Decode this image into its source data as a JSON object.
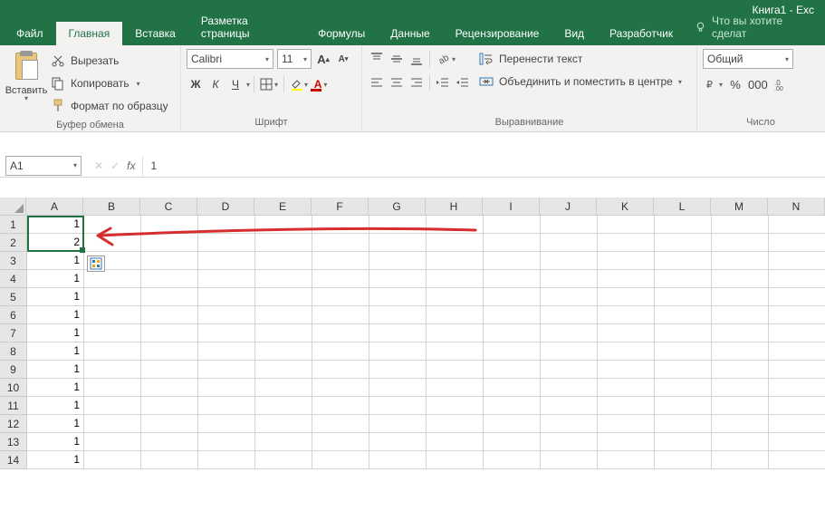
{
  "titlebar": {
    "title": "Книга1 - Exc"
  },
  "tabs": {
    "file": "Файл",
    "items": [
      "Главная",
      "Вставка",
      "Разметка страницы",
      "Формулы",
      "Данные",
      "Рецензирование",
      "Вид",
      "Разработчик"
    ],
    "active_index": 0,
    "tellme": "Что вы хотите сделат"
  },
  "ribbon": {
    "clipboard": {
      "paste": "Вставить",
      "cut": "Вырезать",
      "copy": "Копировать",
      "format_painter": "Формат по образцу",
      "label": "Буфер обмена"
    },
    "font": {
      "name": "Calibri",
      "size": "11",
      "label": "Шрифт",
      "bold": "Ж",
      "italic": "К",
      "underline": "Ч"
    },
    "alignment": {
      "wrap": "Перенести текст",
      "merge": "Объединить и поместить в центре",
      "label": "Выравнивание"
    },
    "number": {
      "format": "Общий",
      "label": "Число"
    }
  },
  "formula_bar": {
    "cell_ref": "A1",
    "formula": "1"
  },
  "grid": {
    "columns": [
      "A",
      "B",
      "C",
      "D",
      "E",
      "F",
      "G",
      "H",
      "I",
      "J",
      "K",
      "L",
      "M",
      "N"
    ],
    "rows": [
      {
        "n": "1",
        "A": "1"
      },
      {
        "n": "2",
        "A": "2"
      },
      {
        "n": "3",
        "A": "1"
      },
      {
        "n": "4",
        "A": "1"
      },
      {
        "n": "5",
        "A": "1"
      },
      {
        "n": "6",
        "A": "1"
      },
      {
        "n": "7",
        "A": "1"
      },
      {
        "n": "8",
        "A": "1"
      },
      {
        "n": "9",
        "A": "1"
      },
      {
        "n": "10",
        "A": "1"
      },
      {
        "n": "11",
        "A": "1"
      },
      {
        "n": "12",
        "A": "1"
      },
      {
        "n": "13",
        "A": "1"
      },
      {
        "n": "14",
        "A": "1"
      }
    ],
    "selection": {
      "col": "A",
      "row_start": 1,
      "row_end": 2
    }
  }
}
